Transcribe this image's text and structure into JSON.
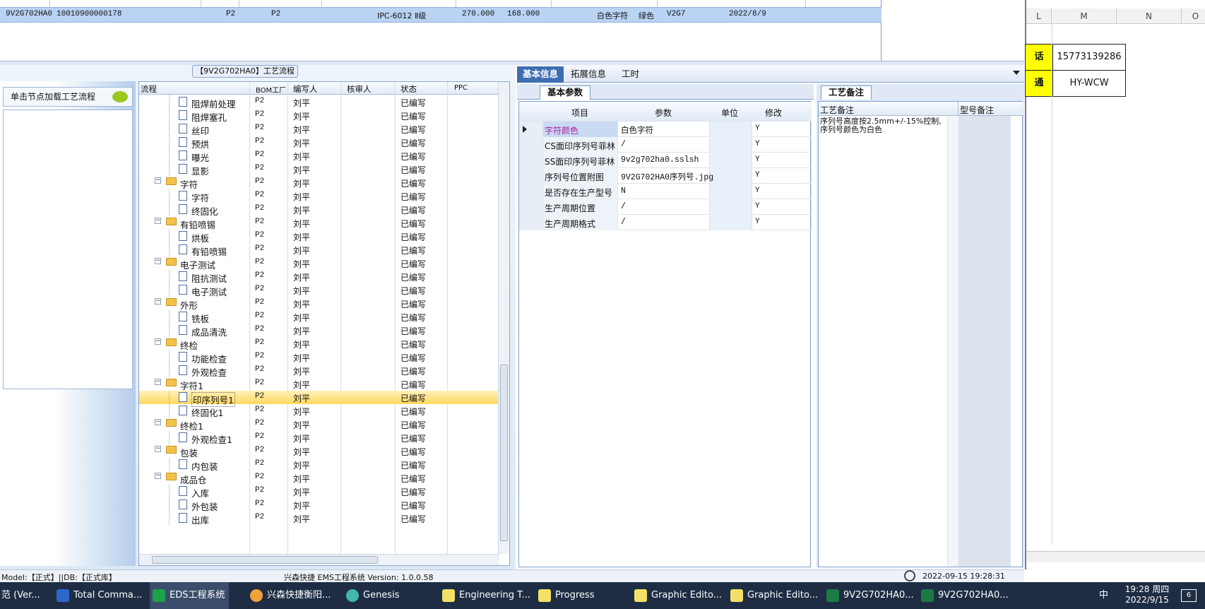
{
  "top_grid": {
    "row": [
      "9V2G702HA0",
      "10010900000178",
      "P2",
      "P2",
      "IPC-6012 Ⅱ级",
      "270.000",
      "168.000",
      "白色字符",
      "绿色",
      "V2G7",
      "2022/8/9"
    ]
  },
  "flow_title": "【9V2G702HA0】工艺流程",
  "sidebar": {
    "header": "单击节点加载工艺流程"
  },
  "tree": {
    "headers": [
      "流程",
      "BOM工厂",
      "编写人",
      "核审人",
      "状态",
      "PPC"
    ],
    "rows": [
      {
        "label": "阻焊前处理",
        "type": "leaf",
        "bom": "P2",
        "writer": "刘平",
        "status": "已编写"
      },
      {
        "label": "阻焊塞孔",
        "type": "leaf",
        "bom": "P2",
        "writer": "刘平",
        "status": "已编写"
      },
      {
        "label": "丝印",
        "type": "leaf",
        "bom": "P2",
        "writer": "刘平",
        "status": "已编写"
      },
      {
        "label": "预烘",
        "type": "leaf",
        "bom": "P2",
        "writer": "刘平",
        "status": "已编写"
      },
      {
        "label": "曝光",
        "type": "leaf",
        "bom": "P2",
        "writer": "刘平",
        "status": "已编写"
      },
      {
        "label": "显影",
        "type": "leaf",
        "bom": "P2",
        "writer": "刘平",
        "status": "已编写"
      },
      {
        "label": "字符",
        "type": "folder",
        "bom": "P2",
        "writer": "刘平",
        "status": "已编写"
      },
      {
        "label": "字符",
        "type": "leaf",
        "bom": "P2",
        "writer": "刘平",
        "status": "已编写"
      },
      {
        "label": "终固化",
        "type": "leaf",
        "bom": "P2",
        "writer": "刘平",
        "status": "已编写"
      },
      {
        "label": "有铅喷锡",
        "type": "folder",
        "bom": "P2",
        "writer": "刘平",
        "status": "已编写"
      },
      {
        "label": "烘板",
        "type": "leaf",
        "bom": "P2",
        "writer": "刘平",
        "status": "已编写"
      },
      {
        "label": "有铅喷锡",
        "type": "leaf",
        "bom": "P2",
        "writer": "刘平",
        "status": "已编写"
      },
      {
        "label": "电子测试",
        "type": "folder",
        "bom": "P2",
        "writer": "刘平",
        "status": "已编写"
      },
      {
        "label": "阻抗测试",
        "type": "leaf",
        "bom": "P2",
        "writer": "刘平",
        "status": "已编写"
      },
      {
        "label": "电子测试",
        "type": "leaf",
        "bom": "P2",
        "writer": "刘平",
        "status": "已编写"
      },
      {
        "label": "外形",
        "type": "folder",
        "bom": "P2",
        "writer": "刘平",
        "status": "已编写"
      },
      {
        "label": "铣板",
        "type": "leaf",
        "bom": "P2",
        "writer": "刘平",
        "status": "已编写"
      },
      {
        "label": "成品清洗",
        "type": "leaf",
        "bom": "P2",
        "writer": "刘平",
        "status": "已编写"
      },
      {
        "label": "终检",
        "type": "folder",
        "bom": "P2",
        "writer": "刘平",
        "status": "已编写"
      },
      {
        "label": "功能检查",
        "type": "leaf",
        "bom": "P2",
        "writer": "刘平",
        "status": "已编写"
      },
      {
        "label": "外观检查",
        "type": "leaf",
        "bom": "P2",
        "writer": "刘平",
        "status": "已编写"
      },
      {
        "label": "字符1",
        "type": "folder",
        "bom": "P2",
        "writer": "刘平",
        "status": "已编写"
      },
      {
        "label": "印序列号1",
        "type": "leaf",
        "bom": "P2",
        "writer": "刘平",
        "status": "已编写",
        "selected": true
      },
      {
        "label": "终固化1",
        "type": "leaf",
        "bom": "P2",
        "writer": "刘平",
        "status": "已编写"
      },
      {
        "label": "终检1",
        "type": "folder",
        "bom": "P2",
        "writer": "刘平",
        "status": "已编写"
      },
      {
        "label": "外观检查1",
        "type": "leaf",
        "bom": "P2",
        "writer": "刘平",
        "status": "已编写"
      },
      {
        "label": "包装",
        "type": "folder",
        "bom": "P2",
        "writer": "刘平",
        "status": "已编写"
      },
      {
        "label": "内包装",
        "type": "leaf",
        "bom": "P2",
        "writer": "刘平",
        "status": "已编写"
      },
      {
        "label": "成品仓",
        "type": "folder",
        "bom": "P2",
        "writer": "刘平",
        "status": "已编写"
      },
      {
        "label": "入库",
        "type": "leaf",
        "bom": "P2",
        "writer": "刘平",
        "status": "已编写"
      },
      {
        "label": "外包装",
        "type": "leaf",
        "bom": "P2",
        "writer": "刘平",
        "status": "已编写"
      },
      {
        "label": "出库",
        "type": "leaf",
        "bom": "P2",
        "writer": "刘平",
        "status": "已编写"
      }
    ]
  },
  "tabs": [
    "基本信息",
    "拓展信息",
    "工时"
  ],
  "params_tab": "基本参数",
  "params": {
    "headers": [
      "项目",
      "参数",
      "单位",
      "修改"
    ],
    "rows": [
      {
        "item": "字符颜色",
        "value": "白色字符",
        "unit": "",
        "mod": "Y",
        "highlight": true
      },
      {
        "item": "CS面印序列号菲林",
        "value": "/",
        "unit": "",
        "mod": "Y"
      },
      {
        "item": "SS面印序列号菲林",
        "value": "9v2g702ha0.sslsh",
        "unit": "",
        "mod": "Y"
      },
      {
        "item": "序列号位置附图",
        "value": "9V2G702HA0序列号.jpg",
        "unit": "",
        "mod": "Y"
      },
      {
        "item": "是否存在生产型号",
        "value": "N",
        "unit": "",
        "mod": "Y"
      },
      {
        "item": "生产周期位置",
        "value": "/",
        "unit": "",
        "mod": "Y"
      },
      {
        "item": "生产周期格式",
        "value": "/",
        "unit": "",
        "mod": "Y"
      }
    ]
  },
  "notes": {
    "tab": "工艺备注",
    "headers": [
      "工艺备注",
      "型号备注"
    ],
    "text1": "序列号高度按2.5mm+/-15%控制,",
    "text2": "序列号颜色为白色"
  },
  "status_bar": {
    "left": "Model:【正式】||DB:【正式库】",
    "center": "兴森快捷 EMS工程系统 Version: 1.0.0.58",
    "right": "2022-09-15 19:28:31"
  },
  "excel": {
    "columns": [
      "L",
      "M",
      "N",
      "O"
    ],
    "cells": [
      "15773139286",
      "HY-WCW"
    ],
    "partial": [
      "话",
      "通"
    ]
  },
  "taskbar": {
    "items": [
      "范 (Ver...",
      "Total Comma...",
      "EDS工程系统",
      "兴森快捷衡阳...",
      "Genesis",
      "Engineering T...",
      "Progress",
      "Graphic Edito...",
      "Graphic Edito...",
      "9V2G702HA0...",
      "9V2G702HA0..."
    ],
    "time": "19:28 周四",
    "date": "2022/9/15",
    "ime": "中",
    "notifications": "6"
  },
  "colors": {
    "accent": "#3f6db0",
    "selection": "#ffd861",
    "excel_yellow": "#ffff00"
  }
}
